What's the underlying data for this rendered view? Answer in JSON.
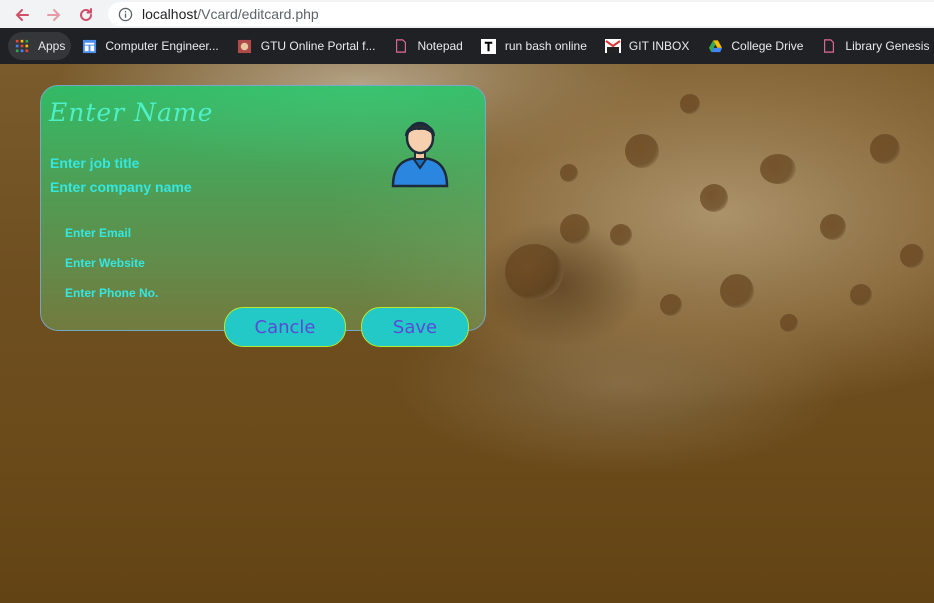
{
  "browser": {
    "url_host": "localhost",
    "url_path": "/Vcard/editcard.php",
    "bookmarks": [
      {
        "label": "Apps",
        "icon": "apps-grid-icon"
      },
      {
        "label": "Computer Engineer...",
        "icon": "doc-blue-icon"
      },
      {
        "label": "GTU Online Portal f...",
        "icon": "gtu-icon"
      },
      {
        "label": "Notepad",
        "icon": "page-icon"
      },
      {
        "label": "run bash online",
        "icon": "t-icon"
      },
      {
        "label": "GIT INBOX",
        "icon": "gmail-icon"
      },
      {
        "label": "College Drive",
        "icon": "drive-icon"
      },
      {
        "label": "Library Genesis",
        "icon": "page-icon"
      }
    ]
  },
  "card": {
    "name": "Enter Name",
    "job_title": "Enter job title",
    "company": "Enter company name",
    "email": "Enter Email",
    "website": "Enter Website",
    "phone": "Enter Phone No."
  },
  "actions": {
    "cancel_label": "Cancle",
    "save_label": "Save"
  },
  "colors": {
    "card_text": "#36e7e0",
    "button_bg": "#22c9c6",
    "button_text": "#5a4ad6",
    "button_border": "#b8e830"
  }
}
